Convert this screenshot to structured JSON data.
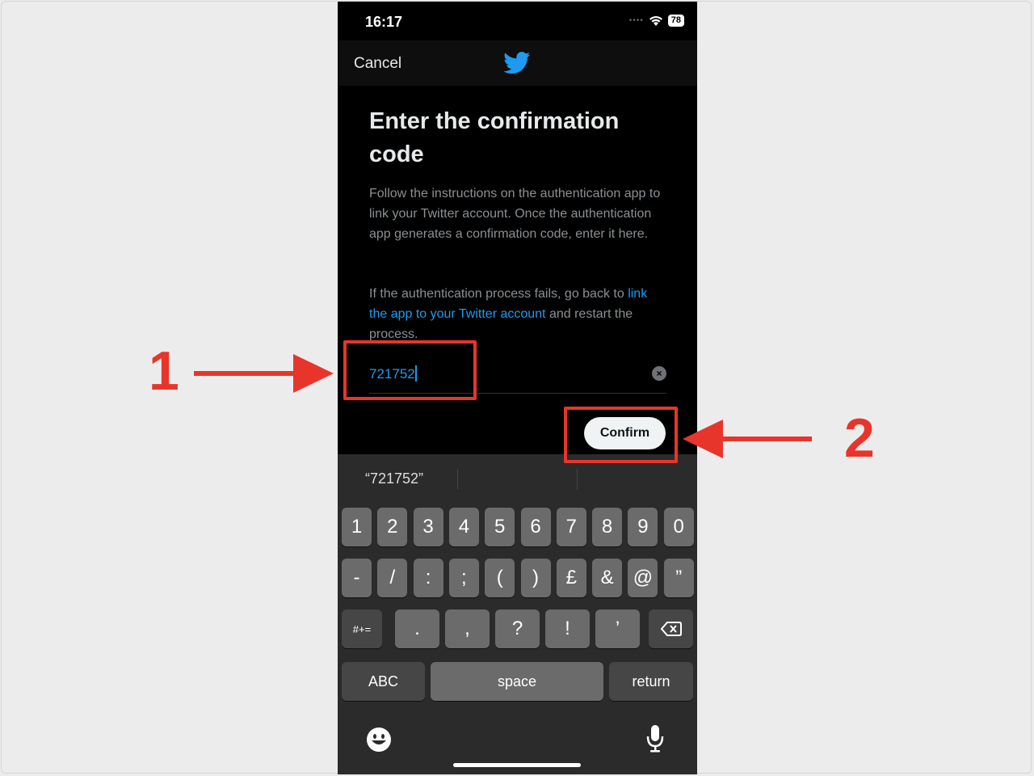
{
  "status": {
    "time": "16:17",
    "battery": "78"
  },
  "nav": {
    "cancel_label": "Cancel"
  },
  "screen": {
    "title": "Enter the confirmation code",
    "paragraph1": "Follow the instructions on the authentication app to link your Twitter account. Once the authentication app generates a confirmation code, enter it here.",
    "paragraph2_prefix": "If the authentication process fails, go back to ",
    "paragraph2_link": "link the app to your Twitter account",
    "paragraph2_suffix": " and restart the process.",
    "code_value": "721752",
    "confirm_label": "Confirm"
  },
  "keyboard": {
    "suggestion": "“721752”",
    "row1": [
      "1",
      "2",
      "3",
      "4",
      "5",
      "6",
      "7",
      "8",
      "9",
      "0"
    ],
    "row2": [
      "-",
      "/",
      ":",
      ";",
      "(",
      ")",
      "£",
      "&",
      "@",
      "”"
    ],
    "row3_toggle": "#+=",
    "row3": [
      ".",
      ",",
      "?",
      "!",
      "’"
    ],
    "abc_label": "ABC",
    "space_label": "space",
    "return_label": "return"
  },
  "annotations": {
    "label1": "1",
    "label2": "2"
  },
  "colors": {
    "accent": "#1d9bf0",
    "annotation": "#e8352b"
  },
  "icons": [
    "twitter-bird-icon",
    "wifi-icon",
    "battery-icon",
    "clear-icon",
    "backspace-icon",
    "emoji-icon",
    "microphone-icon"
  ]
}
